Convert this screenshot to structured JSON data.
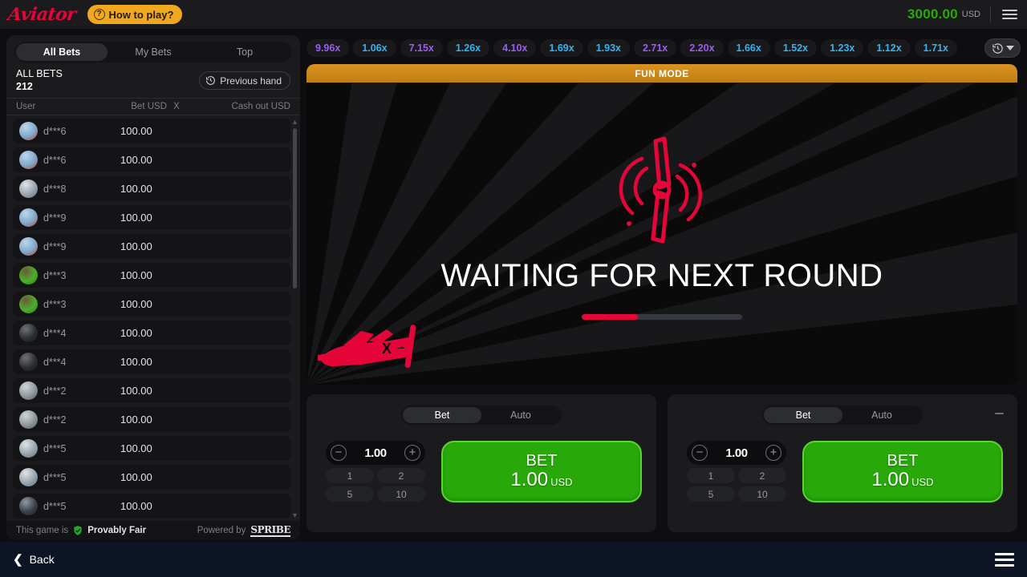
{
  "topbar": {
    "logo": "Aviator",
    "how_to_play": "How to play?",
    "help_icon": "question-mark-icon",
    "balance": "3000.00",
    "currency": "USD",
    "menu_icon": "hamburger-menu-icon"
  },
  "sidebar": {
    "tabs": [
      {
        "label": "All Bets",
        "active": true
      },
      {
        "label": "My Bets",
        "active": false
      },
      {
        "label": "Top",
        "active": false
      }
    ],
    "all_bets_label": "ALL BETS",
    "all_bets_count": "212",
    "previous_hand": "Previous hand",
    "previous_hand_icon": "history-clock-icon",
    "columns": {
      "user": "User",
      "bet": "Bet USD",
      "x": "X",
      "cashout": "Cash out USD"
    },
    "rows": [
      {
        "user": "d***6",
        "bet": "100.00",
        "avatar": "plane-avatar"
      },
      {
        "user": "d***6",
        "bet": "100.00",
        "avatar": "plane-avatar"
      },
      {
        "user": "d***8",
        "bet": "100.00",
        "avatar": "money-avatar"
      },
      {
        "user": "d***9",
        "bet": "100.00",
        "avatar": "plane-avatar"
      },
      {
        "user": "d***9",
        "bet": "100.00",
        "avatar": "plane-avatar"
      },
      {
        "user": "d***3",
        "bet": "100.00",
        "avatar": "clover-avatar"
      },
      {
        "user": "d***3",
        "bet": "100.00",
        "avatar": "clover-avatar"
      },
      {
        "user": "d***4",
        "bet": "100.00",
        "avatar": "car-avatar"
      },
      {
        "user": "d***4",
        "bet": "100.00",
        "avatar": "car-avatar"
      },
      {
        "user": "d***2",
        "bet": "100.00",
        "avatar": "jet-avatar"
      },
      {
        "user": "d***2",
        "bet": "100.00",
        "avatar": "jet-avatar"
      },
      {
        "user": "d***5",
        "bet": "100.00",
        "avatar": "money-avatar"
      },
      {
        "user": "d***5",
        "bet": "100.00",
        "avatar": "money-avatar"
      },
      {
        "user": "d***5",
        "bet": "100.00",
        "avatar": "person-avatar"
      }
    ],
    "footer": {
      "this_game_is": "This game is",
      "provably_fair": "Provably Fair",
      "shield_icon": "shield-check-icon",
      "powered_by": "Powered by",
      "brand": "SPRIBE"
    }
  },
  "history": {
    "items": [
      {
        "value": "9.96x",
        "color": "#9b5cf0"
      },
      {
        "value": "1.06x",
        "color": "#34b3f1"
      },
      {
        "value": "7.15x",
        "color": "#9b5cf0"
      },
      {
        "value": "1.26x",
        "color": "#34b3f1"
      },
      {
        "value": "4.10x",
        "color": "#9b5cf0"
      },
      {
        "value": "1.69x",
        "color": "#34b3f1"
      },
      {
        "value": "1.93x",
        "color": "#34b3f1"
      },
      {
        "value": "2.71x",
        "color": "#9b5cf0"
      },
      {
        "value": "2.20x",
        "color": "#9b5cf0"
      },
      {
        "value": "1.66x",
        "color": "#34b3f1"
      },
      {
        "value": "1.52x",
        "color": "#34b3f1"
      },
      {
        "value": "1.23x",
        "color": "#34b3f1"
      },
      {
        "value": "1.12x",
        "color": "#34b3f1"
      },
      {
        "value": "1.71x",
        "color": "#34b3f1"
      }
    ],
    "toggle_icon": "history-clock-icon",
    "caret_icon": "chevron-down-icon"
  },
  "game": {
    "mode_banner": "FUN MODE",
    "status_text": "WAITING FOR NEXT ROUND",
    "progress_percent": 35,
    "progress_color": "#e50539",
    "propeller_icon": "spinning-propeller-icon",
    "plane_icon": "red-plane-icon",
    "accent_color": "#e50539"
  },
  "bet_panels": [
    {
      "tabs": [
        {
          "label": "Bet",
          "active": true
        },
        {
          "label": "Auto",
          "active": false
        }
      ],
      "stake": "1.00",
      "decrease_icon": "minus-circle-icon",
      "increase_icon": "plus-circle-icon",
      "quick_amounts": [
        "1",
        "2",
        "5",
        "10"
      ],
      "bet_button": {
        "line1": "BET",
        "amount": "1.00",
        "currency": "USD"
      },
      "has_minimize": false
    },
    {
      "tabs": [
        {
          "label": "Bet",
          "active": true
        },
        {
          "label": "Auto",
          "active": false
        }
      ],
      "stake": "1.00",
      "decrease_icon": "minus-circle-icon",
      "increase_icon": "plus-circle-icon",
      "quick_amounts": [
        "1",
        "2",
        "5",
        "10"
      ],
      "bet_button": {
        "line1": "BET",
        "amount": "1.00",
        "currency": "USD"
      },
      "has_minimize": true,
      "minimize_icon": "minimize-icon"
    }
  ],
  "bottombar": {
    "back_label": "Back",
    "back_icon": "chevron-left-icon",
    "menu_icon": "hamburger-menu-icon"
  }
}
